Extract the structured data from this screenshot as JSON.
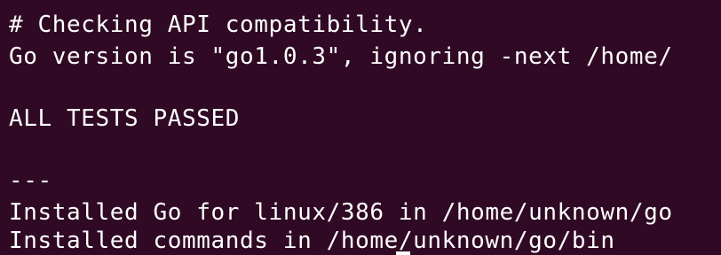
{
  "terminal": {
    "background": "#300a24",
    "foreground": "#ffffff",
    "lines": [
      "# Checking API compatibility.",
      "Go version is \"go1.0.3\", ignoring -next /home/",
      "ALL TESTS PASSED",
      "---",
      "Installed Go for linux/386 in /home/unknown/go",
      "Installed commands in /home/unknown/go/bin"
    ]
  }
}
